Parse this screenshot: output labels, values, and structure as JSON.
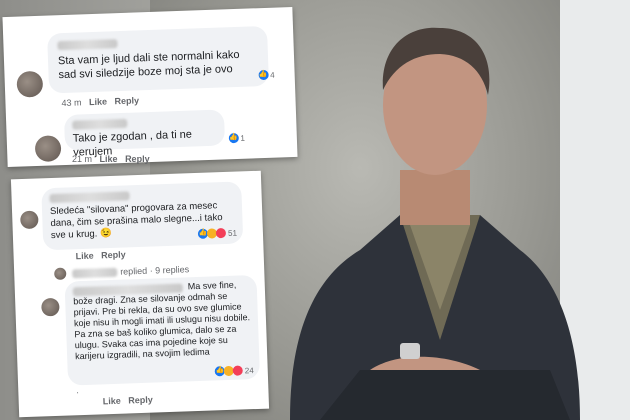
{
  "comments_top": [
    {
      "text": "Sta vam  je ljud dali ste normalni kako sad svi siledzije boze moj sta je ovo",
      "time": "43 m",
      "like": "Like",
      "reply": "Reply",
      "reactions": "4"
    },
    {
      "text": "Tako je zgodan , da ti ne verujem",
      "time": "21 m",
      "like": "Like",
      "reply": "Reply",
      "reactions": "1"
    }
  ],
  "comments_bottom": {
    "first": {
      "text": "Sledeća \"silovana\" progovara za mesec dana, čim se prašina malo slegne...i tako sve u krug. 😉",
      "time": "",
      "like": "Like",
      "reply": "Reply",
      "reactions": "51"
    },
    "replied": {
      "text": "replied · 9 replies"
    },
    "second": {
      "text": "Ma sve fine, bože dragi. Zna se silovanje odmah se prijavi. Pre bi rekla, da su ovo sve glumice koje nisu ih mogli imati ili uslugu nisu dobile. Pa zna se baš koliko glumica, dalo se za ulugu. Svaka cas ima pojedine koje su karijeru izgradili, na svojim ledima",
      "dot": ".",
      "like": "Like",
      "reply": "Reply",
      "reactions": "24"
    }
  },
  "colors": {
    "facebook_blue": "#1877f2",
    "bubble_gray": "#f0f2f5"
  }
}
